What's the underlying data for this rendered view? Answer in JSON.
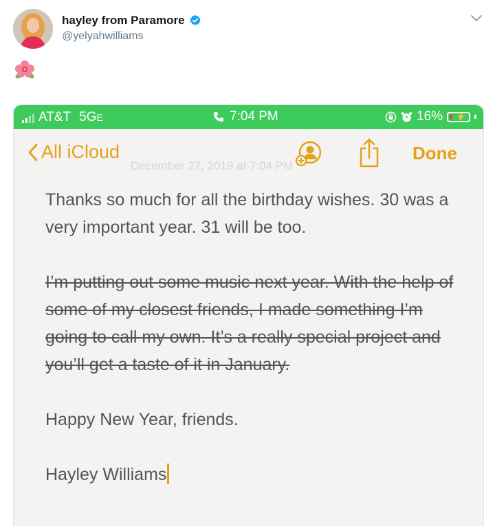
{
  "tweet": {
    "display_name": "hayley from Paramore",
    "handle": "@yelyahwilliams",
    "verified_icon": "verified-badge-icon",
    "menu_icon": "chevron-down-icon",
    "emoji_icon": "hibiscus-icon"
  },
  "phone": {
    "status": {
      "carrier": "AT&T",
      "network": "5G",
      "network_suffix": "E",
      "time": "7:04 PM",
      "battery": "16%",
      "battery_level_percent": 16
    },
    "nav": {
      "back_label": "All iCloud",
      "done_label": "Done"
    },
    "note": {
      "date": "December 27, 2019 at 7:04 PM",
      "paragraph1": "Thanks so much for all the birthday wishes. 30 was a very important year. 31 will be too.",
      "paragraph2_strikethrough": "I’m putting out some music next year. With the help of some of my closest friends, I made something I’m going to call my own. It’s a really special project and you’ll get a taste of it in January.",
      "paragraph3": "Happy New Year, friends.",
      "signature": "Hayley Williams"
    }
  },
  "colors": {
    "status_bar": "#3dcc5c",
    "accent": "#e3a21a",
    "note_text": "#555452",
    "verified": "#1da1f2"
  }
}
